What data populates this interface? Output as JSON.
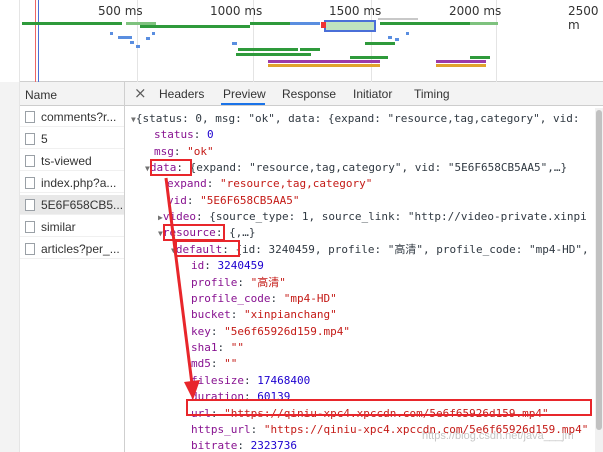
{
  "timeline": {
    "ticks": [
      "500 ms",
      "1000 ms",
      "1500 ms",
      "2000 ms",
      "2500 m"
    ]
  },
  "name_panel": {
    "header": "Name",
    "requests": [
      "comments?r...",
      "5",
      "ts-viewed",
      "index.php?a...",
      "5E6F658CB5...",
      "similar",
      "articles?per_..."
    ],
    "selected_index": 4
  },
  "tabs": {
    "close_glyph": "×",
    "items": [
      "Headers",
      "Preview",
      "Response",
      "Initiator",
      "Timing"
    ],
    "active": "Preview"
  },
  "json_lines": {
    "l1": "{status: 0, msg: \"ok\", data: {expand: \"resource,tag,category\", vid:",
    "status_key": "status",
    "status_val": "0",
    "msg_key": "msg",
    "msg_val": "\"ok\"",
    "data_key": "data",
    "data_summary": "{expand: \"resource,tag,category\", vid: \"5E6F658CB5AA5\",…}",
    "expand_key": "expand",
    "expand_val": "\"resource,tag,category\"",
    "vid_key": "vid",
    "vid_val": "\"5E6F658CB5AA5\"",
    "video_key": "video",
    "video_summary": "{source_type: 1, source_link: \"http://video-private.xinpi",
    "resource_key": "resource",
    "resource_summary": "{,…}",
    "default_key": "default",
    "default_summary": "{id: 3240459, profile: \"高清\", profile_code: \"mp4-HD\",",
    "id_key": "id",
    "id_val": "3240459",
    "profile_key": "profile",
    "profile_val": "\"高清\"",
    "profile_code_key": "profile_code",
    "profile_code_val": "\"mp4-HD\"",
    "bucket_key": "bucket",
    "bucket_val": "\"xinpianchang\"",
    "key_key": "key",
    "key_val": "\"5e6f65926d159.mp4\"",
    "sha1_key": "sha1",
    "sha1_val": "\"\"",
    "md5_key": "md5",
    "md5_val": "\"\"",
    "filesize_key": "filesize",
    "filesize_val": "17468400",
    "duration_key": "duration",
    "duration_val": "60139",
    "url_key": "url",
    "url_val": "\"https://qiniu-xpc4.xpccdn.com/5e6f65926d159.mp4\"",
    "https_url_key": "https_url",
    "https_url_val": "\"https://qiniu-xpc4.xpccdn.com/5e6f65926d159.mp4\"",
    "bitrate_key": "bitrate",
    "bitrate_val": "2323736"
  },
  "watermark": "https://blog.csdn.net/java___jm",
  "colors": {
    "key": "#881391",
    "string": "#c41a16",
    "number": "#1c00cf",
    "highlight_box": "#e8262b",
    "tab_underline": "#1a73e8"
  }
}
